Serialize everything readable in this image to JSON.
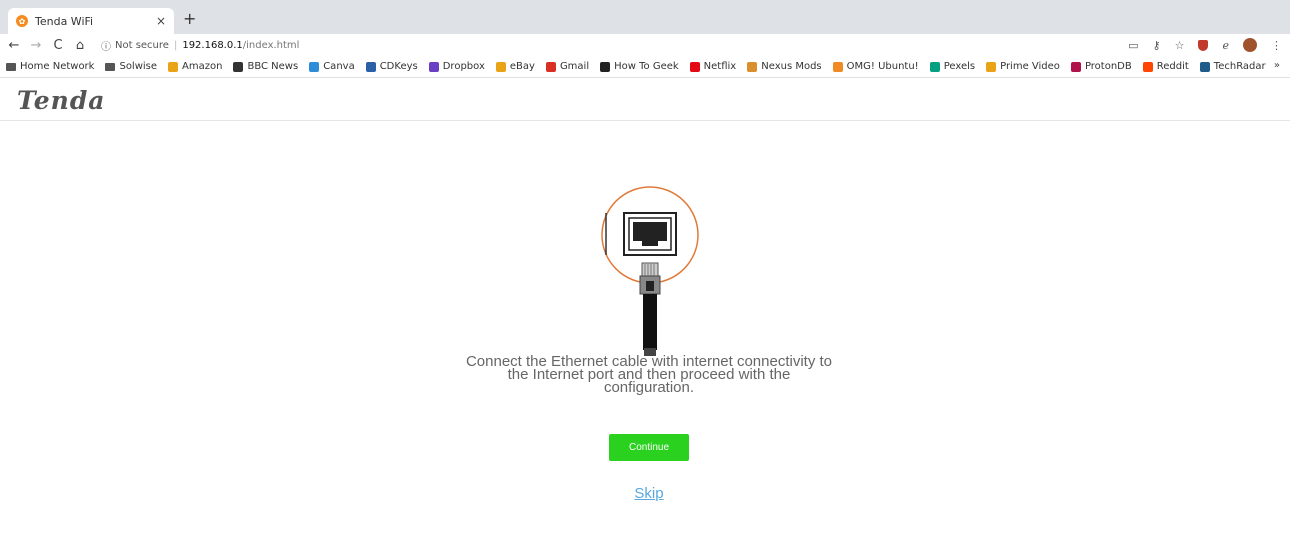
{
  "browser": {
    "tab_title": "Tenda WiFi",
    "tab_close": "×",
    "new_tab": "+",
    "security_label": "Not secure",
    "url_host": "192.168.0.1",
    "url_path": "/index.html",
    "nav_back": "←",
    "nav_forward": "→",
    "nav_reload": "C",
    "nav_home": "⌂",
    "info_glyph": "ⓘ",
    "cast_glyph": "▭",
    "key_glyph": "⚷",
    "star_glyph": "☆",
    "menu_glyph": "⋮"
  },
  "bookmarks": [
    {
      "label": "Home Network",
      "icon": "folder-icon",
      "color": "#555555"
    },
    {
      "label": "Solwise",
      "icon": "folder-icon",
      "color": "#555555"
    },
    {
      "label": "Amazon",
      "icon": "amazon-icon",
      "color": "#e8a317"
    },
    {
      "label": "BBC News",
      "icon": "bbc-icon",
      "color": "#333333"
    },
    {
      "label": "Canva",
      "icon": "canva-icon",
      "color": "#2d8dd8"
    },
    {
      "label": "CDKeys",
      "icon": "cdkeys-icon",
      "color": "#2b5fa6"
    },
    {
      "label": "Dropbox",
      "icon": "dropbox-icon",
      "color": "#6a3fc4"
    },
    {
      "label": "eBay",
      "icon": "ebay-icon",
      "color": "#e8a317"
    },
    {
      "label": "Gmail",
      "icon": "gmail-icon",
      "color": "#d93025"
    },
    {
      "label": "How To Geek",
      "icon": "howtogeek-icon",
      "color": "#222222"
    },
    {
      "label": "Netflix",
      "icon": "netflix-icon",
      "color": "#e50914"
    },
    {
      "label": "Nexus Mods",
      "icon": "nexusmods-icon",
      "color": "#d98f2b"
    },
    {
      "label": "OMG! Ubuntu!",
      "icon": "omgubuntu-icon",
      "color": "#f08a24"
    },
    {
      "label": "Pexels",
      "icon": "pexels-icon",
      "color": "#05a081"
    },
    {
      "label": "Prime Video",
      "icon": "primevideo-icon",
      "color": "#e8a317"
    },
    {
      "label": "ProtonDB",
      "icon": "protondb-icon",
      "color": "#b0124a"
    },
    {
      "label": "Reddit",
      "icon": "reddit-icon",
      "color": "#ff4500"
    },
    {
      "label": "TechRadar",
      "icon": "techradar-icon",
      "color": "#1f5c8a"
    }
  ],
  "bookmarks_more": "»",
  "page": {
    "logo": "Tenda",
    "message_line1": "Connect the Ethernet cable with internet connectivity to",
    "message_line2": "the Internet port and then proceed with the",
    "message_line3": "configuration.",
    "continue_label": "Continue",
    "skip_label": "Skip"
  },
  "colors": {
    "accent_green": "#2ad11f",
    "link_blue": "#5aa7e0",
    "highlight_orange": "#e07a3a"
  }
}
